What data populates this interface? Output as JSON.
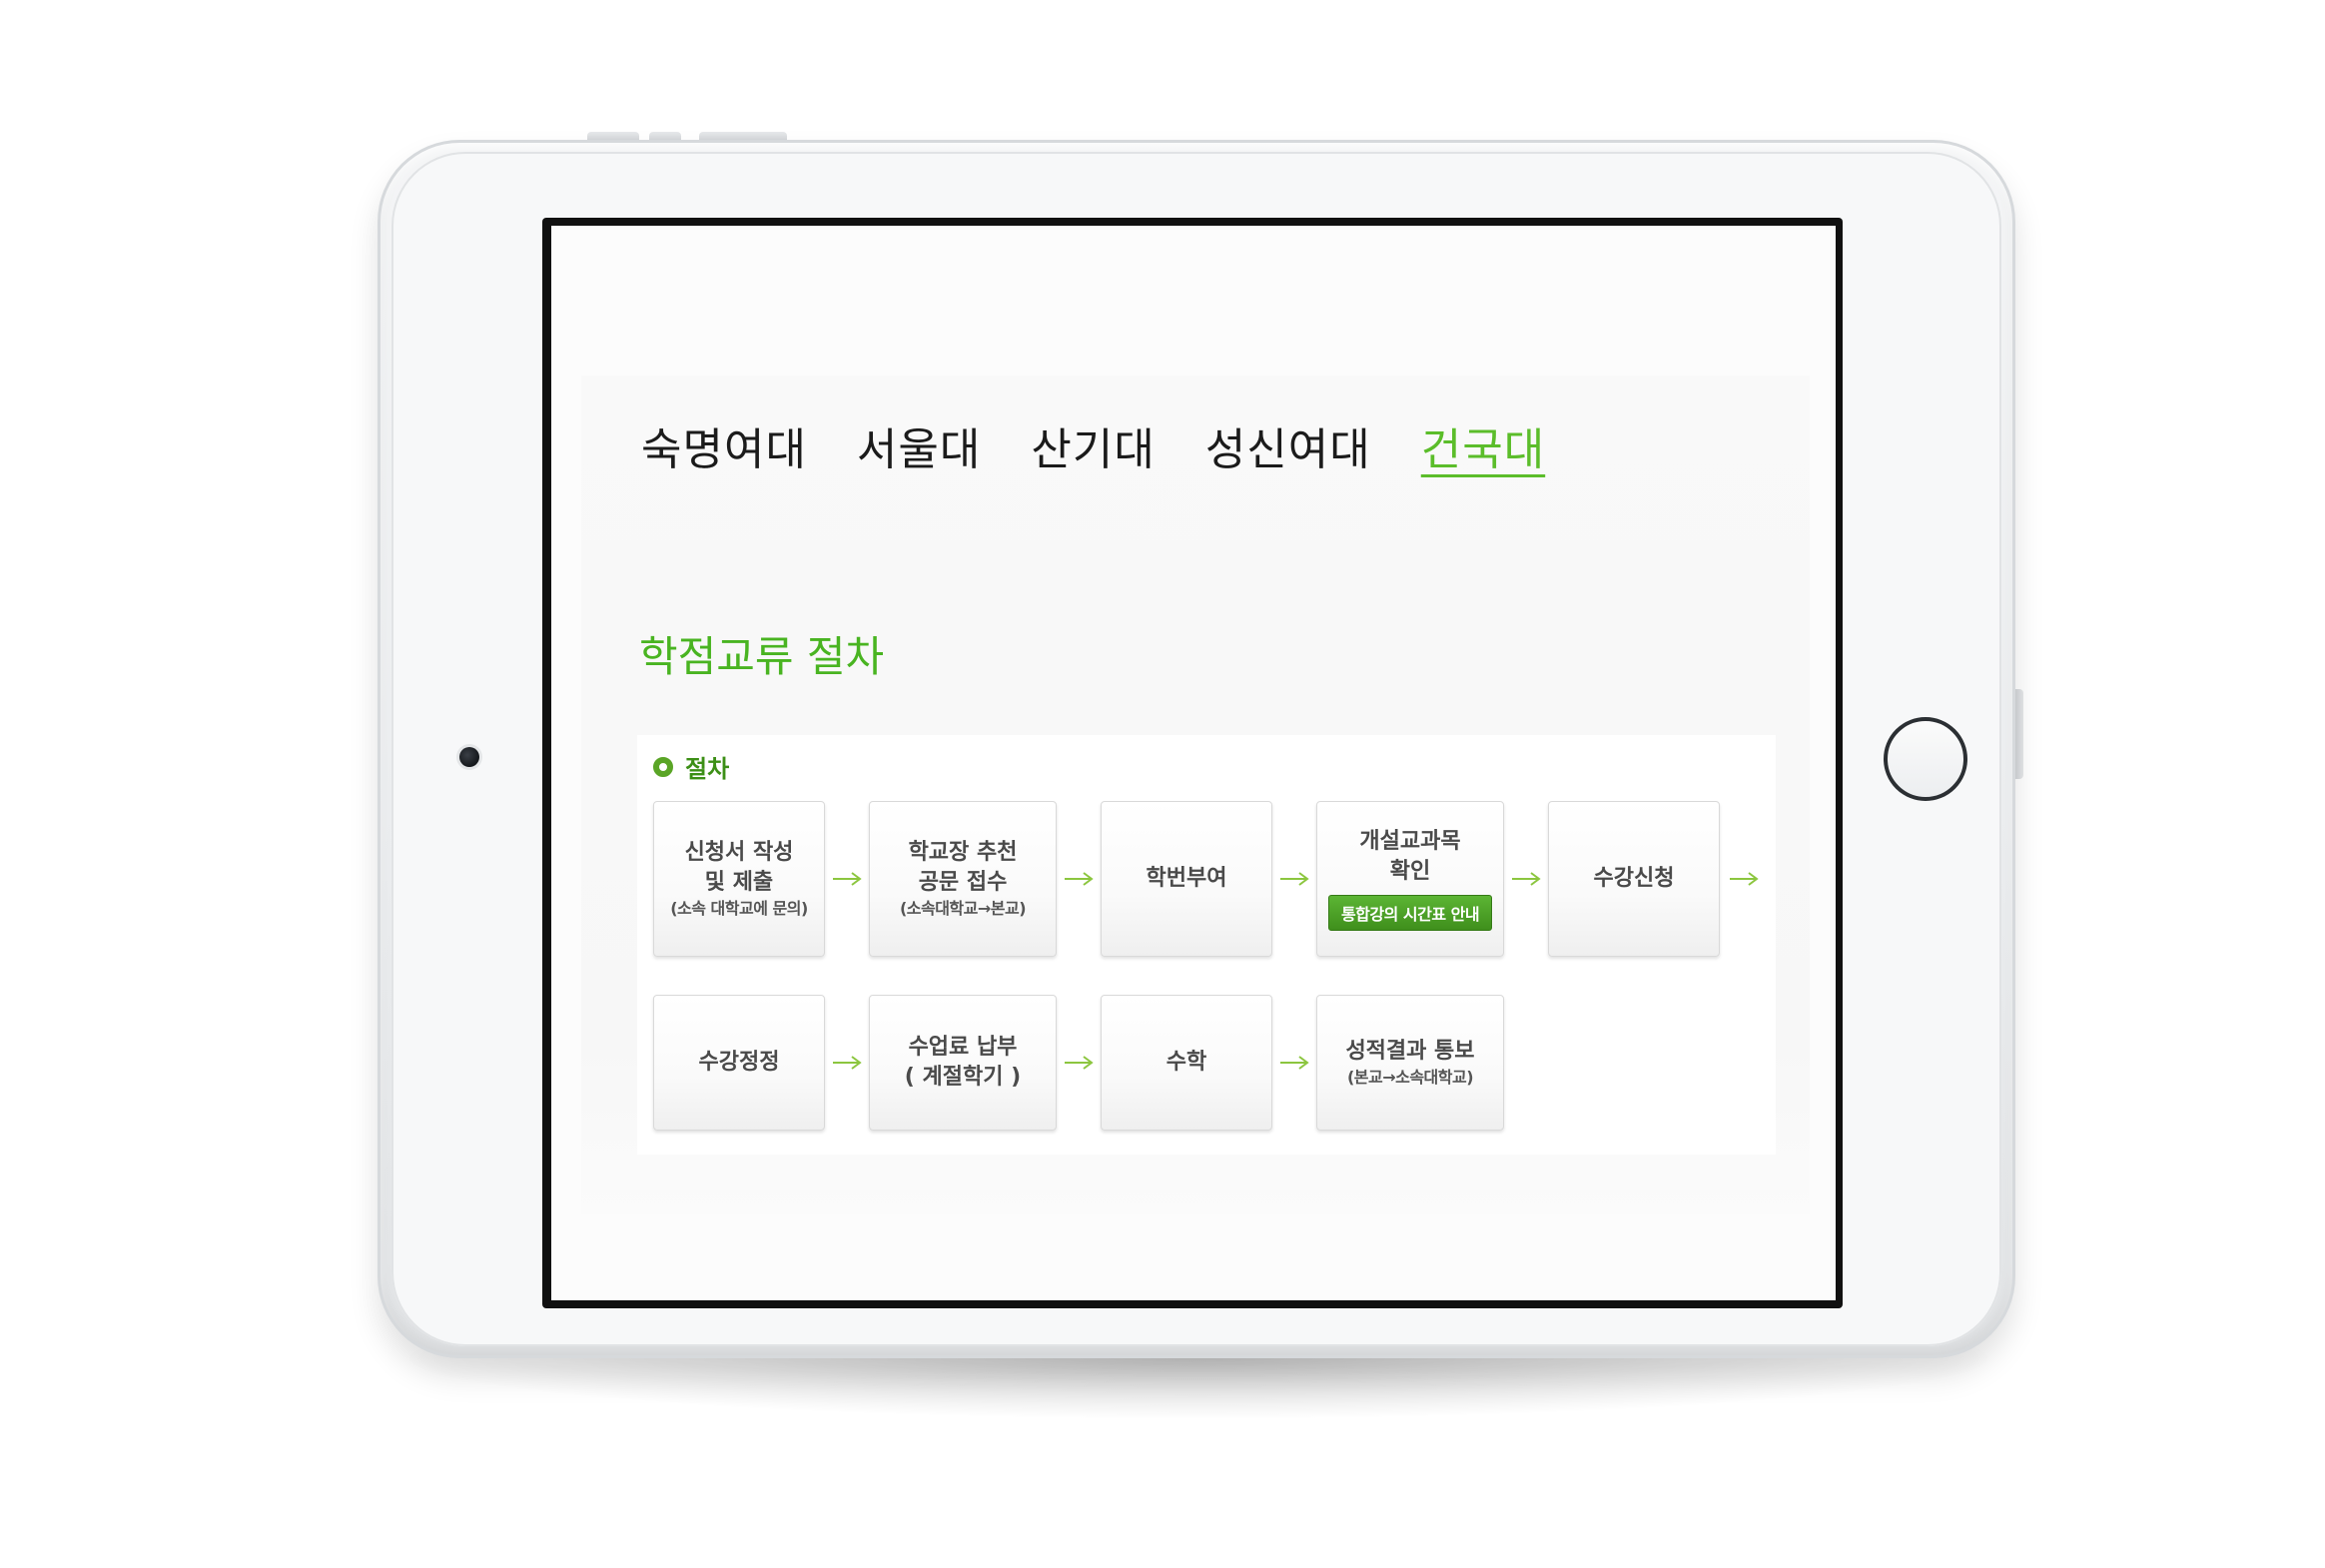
{
  "nav": {
    "tabs": [
      {
        "label": "숙명여대",
        "active": false
      },
      {
        "label": "서울대",
        "active": false
      },
      {
        "label": "산기대",
        "active": false
      },
      {
        "label": "성신여대",
        "active": false
      },
      {
        "label": "건국대",
        "active": true
      }
    ]
  },
  "section": {
    "title": "학점교류 절차"
  },
  "procedure": {
    "title": "절차",
    "steps": [
      {
        "lines": [
          "신청서 작성",
          "및 제출"
        ],
        "sub": "(소속 대학교에 문의)"
      },
      {
        "lines": [
          "학교장 추천",
          "공문 접수"
        ],
        "sub": "(소속대학교→본교)"
      },
      {
        "lines": [
          "학번부여"
        ]
      },
      {
        "lines": [
          "개설교과목",
          "확인"
        ],
        "button": "통합강의 시간표 안내"
      },
      {
        "lines": [
          "수강신청"
        ]
      },
      {
        "lines": [
          "수강정정"
        ]
      },
      {
        "lines": [
          "수업료 납부",
          "( 계절학기 )"
        ]
      },
      {
        "lines": [
          "수학"
        ]
      },
      {
        "lines": [
          "성적결과 통보"
        ],
        "sub": "(본교→소속대학교)"
      }
    ]
  },
  "colors": {
    "accent": "#5bbd2a",
    "title_green": "#49b421",
    "button_green": "#3f8f1c",
    "arrow_green": "#8cc63f"
  }
}
